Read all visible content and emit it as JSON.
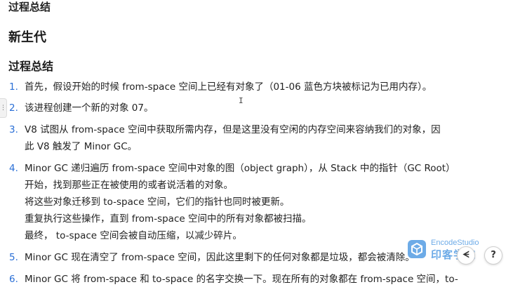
{
  "headings": {
    "top": "过程总结",
    "main": "新生代",
    "sub": "过程总结"
  },
  "list": [
    {
      "number": "1.",
      "lines": [
        "首先，假设开始的时候 from-space 空间上已经有对象了（01-06 蓝色方块被标记为已用内存）。"
      ]
    },
    {
      "number": "2.",
      "lines": [
        "该进程创建一个新的对象 07。"
      ]
    },
    {
      "number": "3.",
      "lines": [
        "V8 试图从 from-space 空间中获取所需内存，但是这里没有空闲的内存空间来容纳我们的对象，因",
        "此 V8 触发了 Minor GC。"
      ]
    },
    {
      "number": "4.",
      "lines": [
        "Minor GC 递归遍历 from-space 空间中对象的图（object graph），从 Stack 中的指针（GC Root）",
        "开始，找到那些正在被使用的或者说活着的对象。",
        "将这些对象迁移到 to-space 空间，它们的指针也同时被更新。",
        "重复执行这些操作，直到 from-space 空间中的所有对象都被扫描。",
        "最终， to-space 空间会被自动压缩，以减少碎片。"
      ]
    },
    {
      "number": "5.",
      "lines": [
        "Minor GC 现在清空了 from-space 空间，因此这里剩下的任何对象都是垃圾，都会被清除。"
      ]
    },
    {
      "number": "6.",
      "lines": [
        "Minor GC 将 from-space 和 to-space 的名字交换一下。现在所有的对象都在 from-space 空间，to-"
      ]
    }
  ],
  "watermark": {
    "brand_en": "EncodeStudio",
    "brand_cn": "印客学院"
  },
  "controls": {
    "side_tab_glyph": "⋮",
    "left_button_glyph": "ᗕ",
    "help_button_glyph": "?"
  },
  "colors": {
    "list_number": "#2a6fd6",
    "watermark": "#3d8fe0"
  }
}
